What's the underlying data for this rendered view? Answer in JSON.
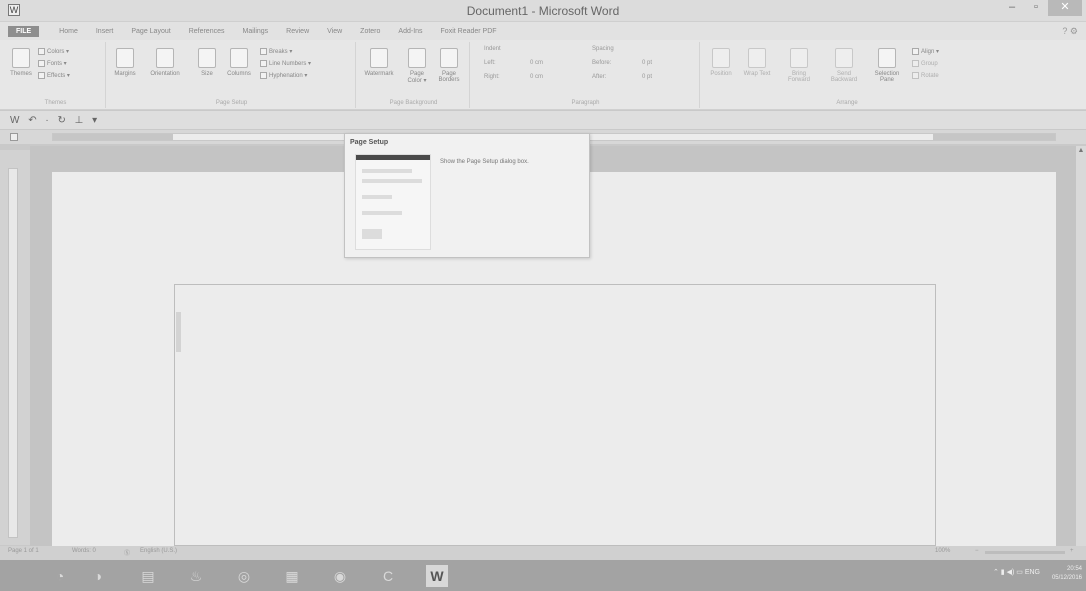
{
  "window": {
    "app_icon": "W",
    "title": "Document1 - Microsoft Word",
    "minimize": "–",
    "maximize": "▫",
    "close": "✕"
  },
  "tabs": [
    {
      "label": "FILE"
    },
    {
      "label": "Home"
    },
    {
      "label": "Insert"
    },
    {
      "label": "Page Layout"
    },
    {
      "label": "References"
    },
    {
      "label": "Mailings"
    },
    {
      "label": "Review"
    },
    {
      "label": "View"
    },
    {
      "label": "Zotero"
    },
    {
      "label": "Add-Ins"
    },
    {
      "label": "Foxit Reader PDF"
    }
  ],
  "help_icon": "? ⚙",
  "ribbon": {
    "themes": {
      "themes_btn": "Themes",
      "colors": "Colors ▾",
      "fonts": "Fonts ▾",
      "effects": "Effects ▾",
      "label": "Themes"
    },
    "page_setup": {
      "margins": "Margins",
      "orientation": "Orientation",
      "size": "Size",
      "columns": "Columns",
      "breaks": "Breaks ▾",
      "line_numbers": "Line Numbers ▾",
      "hyphenation": "Hyphenation ▾",
      "label": "Page Setup"
    },
    "page_background": {
      "watermark": "Watermark",
      "page_color": "Page Color ▾",
      "page_borders": "Page Borders",
      "label": "Page Background"
    },
    "paragraph": {
      "indent": "Indent",
      "left_label": "Left:",
      "left_value": "0 cm",
      "right_label": "Right:",
      "right_value": "0 cm",
      "spacing": "Spacing",
      "before_label": "Before:",
      "before_value": "0 pt",
      "after_label": "After:",
      "after_value": "0 pt",
      "label": "Paragraph"
    },
    "arrange": {
      "position": "Position",
      "wrap_text": "Wrap Text",
      "bring_forward": "Bring Forward",
      "send_backward": "Send Backward",
      "selection_pane": "Selection Pane",
      "align": "Align ▾",
      "group": "Group",
      "rotate": "Rotate",
      "label": "Arrange"
    }
  },
  "qat": "W ↶ · ↻ ⊥ ▾",
  "popup": {
    "title": "Page Setup",
    "description": "Show the Page Setup dialog box."
  },
  "status": {
    "page": "Page 1 of 1",
    "words": "Words: 0",
    "proofing": "Ⓢ",
    "language": "English (U.S.)",
    "zoom": "100%",
    "zoom_minus": "−",
    "zoom_plus": "+"
  },
  "taskbar": {
    "start": "◔",
    "items": [
      "◑",
      "▤",
      "♨",
      "◎",
      "▦",
      "◉",
      "C"
    ],
    "active": "W",
    "tray": "⌃ ▮ ◀) ▭ ENG",
    "time": "20:54",
    "date": "05/12/2016"
  }
}
